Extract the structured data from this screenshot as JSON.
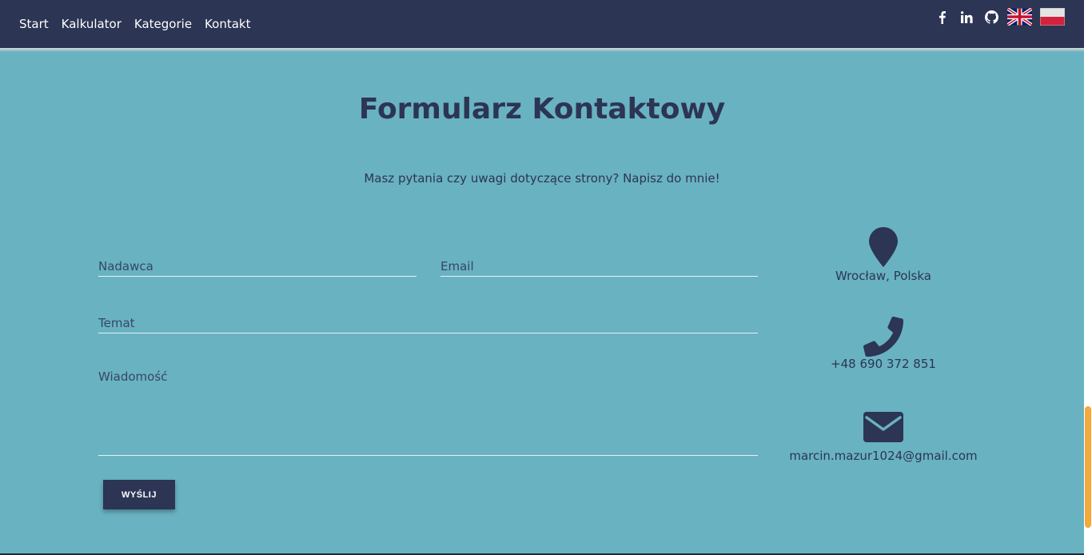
{
  "nav": {
    "links": [
      "Start",
      "Kalkulator",
      "Kategorie",
      "Kontakt"
    ],
    "social_icons": [
      "facebook-icon",
      "linkedin-icon",
      "github-icon"
    ],
    "flags": [
      "uk-flag-icon",
      "poland-flag-icon"
    ]
  },
  "page": {
    "title": "Formularz Kontaktowy",
    "subtitle": "Masz pytania czy uwagi dotyczące strony? Napisz do mnie!"
  },
  "form": {
    "sender_placeholder": "Nadawca",
    "email_placeholder": "Email",
    "subject_placeholder": "Temat",
    "message_placeholder": "Wiadomość",
    "send_label": "WYŚLIJ"
  },
  "contact": {
    "location": "Wrocław, Polska",
    "phone": "+48 690 372 851",
    "email": "marcin.mazur1024@gmail.com"
  },
  "colors": {
    "navbar": "#2c3553",
    "background": "#69b2c1",
    "accent": "#f4a93a"
  }
}
